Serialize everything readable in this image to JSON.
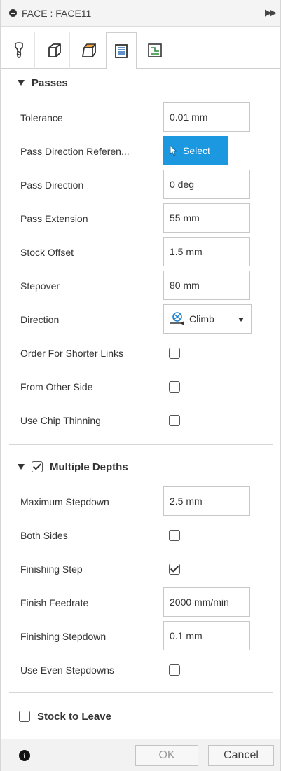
{
  "title": "FACE : FACE11",
  "tabs": [
    {
      "icon": "tool-icon",
      "active": false
    },
    {
      "icon": "geometry-icon",
      "active": false
    },
    {
      "icon": "heights-icon",
      "active": false
    },
    {
      "icon": "passes-icon",
      "active": true
    },
    {
      "icon": "linking-icon",
      "active": false
    }
  ],
  "passes": {
    "header": "Passes",
    "tolerance": {
      "label": "Tolerance",
      "value": "0.01 mm"
    },
    "pass_direction_reference": {
      "label": "Pass Direction Referen...",
      "button": "Select"
    },
    "pass_direction": {
      "label": "Pass Direction",
      "value": "0 deg"
    },
    "pass_extension": {
      "label": "Pass Extension",
      "value": "55 mm"
    },
    "stock_offset": {
      "label": "Stock Offset",
      "value": "1.5 mm"
    },
    "stepover": {
      "label": "Stepover",
      "value": "80 mm"
    },
    "direction": {
      "label": "Direction",
      "value": "Climb"
    },
    "order_for_shorter_links": {
      "label": "Order For Shorter Links",
      "checked": false
    },
    "from_other_side": {
      "label": "From Other Side",
      "checked": false
    },
    "use_chip_thinning": {
      "label": "Use Chip Thinning",
      "checked": false
    }
  },
  "multiple_depths": {
    "header": "Multiple Depths",
    "enabled": true,
    "maximum_stepdown": {
      "label": "Maximum Stepdown",
      "value": "2.5 mm"
    },
    "both_sides": {
      "label": "Both Sides",
      "checked": false
    },
    "finishing_step": {
      "label": "Finishing Step",
      "checked": true
    },
    "finish_feedrate": {
      "label": "Finish Feedrate",
      "value": "2000 mm/min"
    },
    "finishing_stepdown": {
      "label": "Finishing Stepdown",
      "value": "0.1 mm"
    },
    "use_even_stepdowns": {
      "label": "Use Even Stepdowns",
      "checked": false
    }
  },
  "stock_to_leave": {
    "header": "Stock to Leave",
    "enabled": false
  },
  "footer": {
    "ok": "OK",
    "cancel": "Cancel",
    "info_icon": "info-icon"
  },
  "colors": {
    "accent": "#1b98e0"
  }
}
